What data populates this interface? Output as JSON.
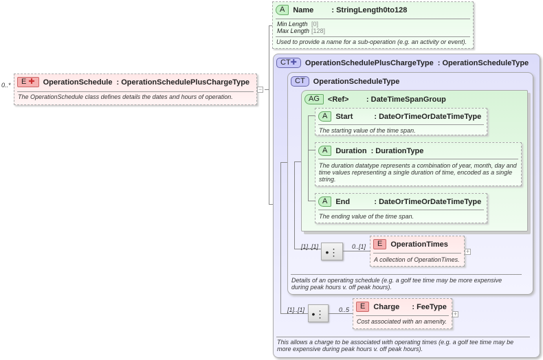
{
  "root": {
    "cardinality": "0..*",
    "badge": "E",
    "name": "OperationSchedule",
    "type": ": OperationSchedulePlusChargeType",
    "description": "The OperationSchedule class defines details the dates and hours of operation."
  },
  "name_attr": {
    "badge": "A",
    "name": "Name",
    "type": ": StringLength0to128",
    "facets": [
      {
        "label": "Min Length",
        "value": "[0]"
      },
      {
        "label": "Max Length",
        "value": "[128]"
      }
    ],
    "description": "Used to provide a name for a sub-operation (e.g. an activity or event)."
  },
  "outer_type": {
    "badge": "CT",
    "name": "OperationSchedulePlusChargeType",
    "base": ": OperationScheduleType",
    "description": "This allows a charge to be associated with operating times (e.g. a golf tee time may be more expensive during peak hours v. off peak hours)."
  },
  "inner_type": {
    "badge": "CT",
    "name": "OperationScheduleType",
    "description": "Details of an operating schedule (e.g. a golf tee time may be more expensive during peak hours v. off peak hours)."
  },
  "attr_group": {
    "badge": "AG",
    "name": "<Ref>",
    "type": ": DateTimeSpanGroup",
    "attributes": [
      {
        "badge": "A",
        "name": "Start",
        "type": ": DateOrTimeOrDateTimeType",
        "description": "The starting value of the time span."
      },
      {
        "badge": "A",
        "name": "Duration",
        "type": ": DurationType",
        "description": "The duration datatype represents a combination of year, month, day and time values representing a single duration of time, encoded as a single string."
      },
      {
        "badge": "A",
        "name": "End",
        "type": ": DateOrTimeOrDateTimeType",
        "description": "The ending value of the time span."
      }
    ]
  },
  "operation_times": {
    "seq_cardinality": "[1]..[1]",
    "cardinality": "0..[1]",
    "badge": "E",
    "name": "OperationTimes",
    "description": "A collection of OperationTimes."
  },
  "charge": {
    "seq_cardinality": "[1]..[1]",
    "cardinality": "0..5",
    "badge": "E",
    "name": "Charge",
    "type": ": FeeType",
    "description": "Cost associated with an amenity."
  },
  "icons": {
    "collapse": "−",
    "expand": "+",
    "plus": "✚",
    "sequence": "•⋮"
  }
}
